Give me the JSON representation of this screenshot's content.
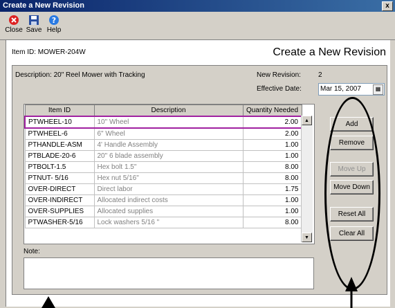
{
  "window": {
    "title": "Create a New Revision",
    "close_glyph": "x"
  },
  "toolbar": [
    {
      "label": "Close",
      "icon": "close-icon"
    },
    {
      "label": "Save",
      "icon": "save-icon"
    },
    {
      "label": "Help",
      "icon": "help-icon"
    }
  ],
  "header": {
    "item_id": "Item ID: MOWER-204W",
    "title": "Create a New Revision"
  },
  "form": {
    "description": "Description: 20\" Reel Mower with Tracking",
    "new_revision_label": "New Revision:",
    "new_revision_value": "2",
    "effective_date_label": "Effective Date:",
    "effective_date_value": "Mar 15, 2007"
  },
  "grid": {
    "columns": [
      "Item ID",
      "Description",
      "Quantity Needed"
    ],
    "rows": [
      [
        "PTWHEEL-10",
        "10\" Wheel",
        "2.00"
      ],
      [
        "PTWHEEL-6",
        "6\" Wheel",
        "2.00"
      ],
      [
        "PTHANDLE-ASM",
        "4' Handle Assembly",
        "1.00"
      ],
      [
        "PTBLADE-20-6",
        "20\" 6 blade assembly",
        "1.00"
      ],
      [
        "PTBOLT-1.5",
        "Hex bolt 1.5\"",
        "8.00"
      ],
      [
        "PTNUT- 5/16",
        "Hex nut 5/16\"",
        "8.00"
      ],
      [
        "OVER-DIRECT",
        "Direct labor",
        "1.75"
      ],
      [
        "OVER-INDIRECT",
        "Allocated indirect costs",
        "1.00"
      ],
      [
        "OVER-SUPPLIES",
        "Allocated supplies",
        "1.00"
      ],
      [
        "PTWASHER-5/16",
        "Lock washers 5/16 \"",
        "8.00"
      ]
    ]
  },
  "buttons": {
    "add": "Add",
    "remove": "Remove",
    "move_up": "Move Up",
    "move_down": "Move Down",
    "reset_all": "Reset All",
    "clear_all": "Clear All"
  },
  "note": {
    "label": "Note:",
    "value": ""
  },
  "colors": {
    "titlebar": "#0a246a",
    "selection_outline": "#a020a0",
    "panel": "#d4d0c8"
  }
}
